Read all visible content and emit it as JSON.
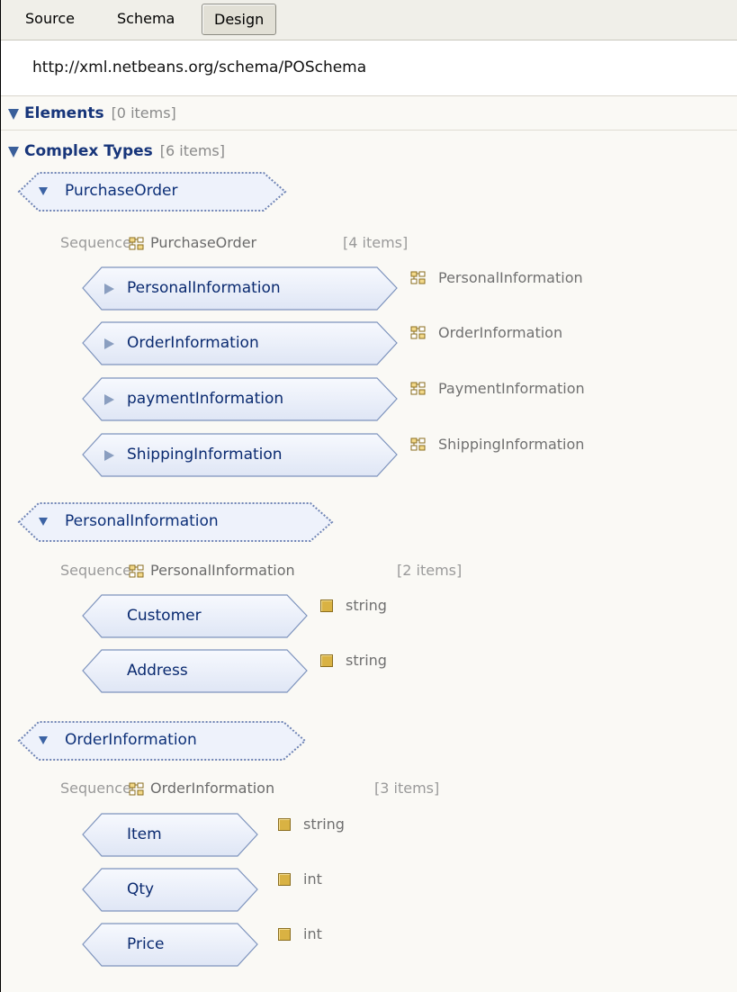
{
  "tabs": {
    "source": "Source",
    "schema": "Schema",
    "design": "Design"
  },
  "namespace": "http://xml.netbeans.org/schema/POSchema",
  "sections": {
    "elements": {
      "title": "Elements",
      "count": "[0 items]"
    },
    "complex_types": {
      "title": "Complex Types",
      "count": "[6 items]"
    }
  },
  "complex_types": [
    {
      "name": "PurchaseOrder",
      "compositor": "Sequence",
      "type_name": "PurchaseOrder",
      "count": "[4 items]",
      "children": [
        {
          "name": "PersonalInformation",
          "type": "PersonalInformation",
          "expandable": true
        },
        {
          "name": "OrderInformation",
          "type": "OrderInformation",
          "expandable": true
        },
        {
          "name": "paymentInformation",
          "type": "PaymentInformation",
          "expandable": true
        },
        {
          "name": "ShippingInformation",
          "type": "ShippingInformation",
          "expandable": true
        }
      ]
    },
    {
      "name": "PersonalInformation",
      "compositor": "Sequence",
      "type_name": "PersonalInformation",
      "count": "[2 items]",
      "children": [
        {
          "name": "Customer",
          "type": "string",
          "expandable": false
        },
        {
          "name": "Address",
          "type": "string",
          "expandable": false
        }
      ]
    },
    {
      "name": "OrderInformation",
      "compositor": "Sequence",
      "type_name": "OrderInformation",
      "count": "[3 items]",
      "children": [
        {
          "name": "Item",
          "type": "string",
          "expandable": false
        },
        {
          "name": "Qty",
          "type": "int",
          "expandable": false
        },
        {
          "name": "Price",
          "type": "int",
          "expandable": false
        }
      ]
    }
  ],
  "icons": {
    "complex_type": "complex-type-icon",
    "simple_type": "simple-type-icon",
    "expand": "expand-triangle-icon",
    "collapse": "collapse-triangle-icon"
  },
  "colors": {
    "title": "#17357a",
    "element_text": "#0a2a70",
    "element_fill": "#e8eef9",
    "element_border": "#7d93bd",
    "background": "#faf9f5"
  }
}
